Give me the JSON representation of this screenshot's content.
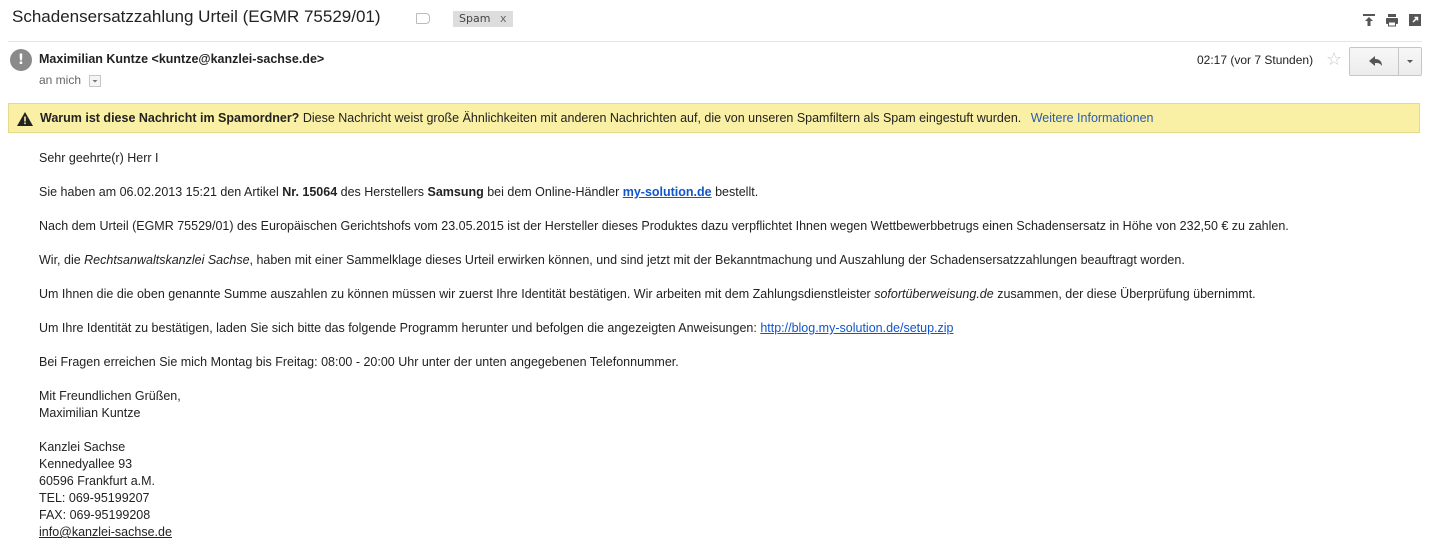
{
  "subject": "Schadensersatzzahlung Urteil (EGMR 75529/01)",
  "spam_label": "Spam",
  "spam_remove": "x",
  "sender": "Maximilian Kuntze <kuntze@kanzlei-sachse.de>",
  "avatar_glyph": "!",
  "to": "an mich",
  "time": "02:17 (vor 7 Stunden)",
  "star": "☆",
  "warning": {
    "title": "Warum ist diese Nachricht im Spamordner?",
    "text": "Diese Nachricht weist große Ähnlichkeiten mit anderen Nachrichten auf, die von unseren Spamfiltern als Spam eingestuft wurden.",
    "link": "Weitere Informationen"
  },
  "body": {
    "greeting": "Sehr geehrte(r) Herr I",
    "p1": {
      "a": "Sie haben am 06.02.2013 15:21 den Artikel ",
      "b1": "Nr. 15064",
      "c": " des Herstellers ",
      "b2": "Samsung",
      "d": " bei dem Online-Händler ",
      "link": "my-solution.de",
      "e": " bestellt."
    },
    "p2": "Nach dem Urteil (EGMR 75529/01) des Europäischen Gerichtshofs vom 23.05.2015 ist der Hersteller dieses Produktes dazu verpflichtet Ihnen wegen Wettbewerbbetrugs einen Schadensersatz in Höhe von 232,50 € zu zahlen.",
    "p3": {
      "a": "Wir, die ",
      "i": "Rechtsanwaltskanzlei Sachse",
      "b": ", haben mit einer Sammelklage dieses Urteil erwirken können, und sind jetzt mit der Bekanntmachung und Auszahlung der Schadensersatzzahlungen beauftragt worden."
    },
    "p4": {
      "a": "Um Ihnen die die oben genannte Summe auszahlen zu können müssen wir zuerst Ihre Identität bestätigen. Wir arbeiten mit dem Zahlungsdienstleister ",
      "i": "sofortüberweisung.de",
      "b": " zusammen, der diese Überprüfung übernimmt."
    },
    "p5": {
      "a": "Um Ihre Identität zu bestätigen, laden Sie sich bitte das folgende Programm herunter und befolgen die angezeigten Anweisungen: ",
      "link": "http://blog.my-solution.de/setup.zip"
    },
    "p6": "Bei Fragen erreichen Sie mich Montag bis Freitag: 08:00 - 20:00 Uhr unter der unten angegebenen Telefonnummer.",
    "closing1": "Mit Freundlichen Grüßen,",
    "closing2": "Maximilian Kuntze",
    "sig": [
      "Kanzlei Sachse",
      "Kennedyallee 93",
      "60596 Frankfurt a.M.",
      "TEL: 069-95199207",
      "FAX: 069-95199208"
    ],
    "sig_email": "info@kanzlei-sachse.de"
  },
  "colors": {
    "warning_bg": "#faf0a5",
    "link": "#1155cc",
    "avatar": "#8a8a8a"
  }
}
